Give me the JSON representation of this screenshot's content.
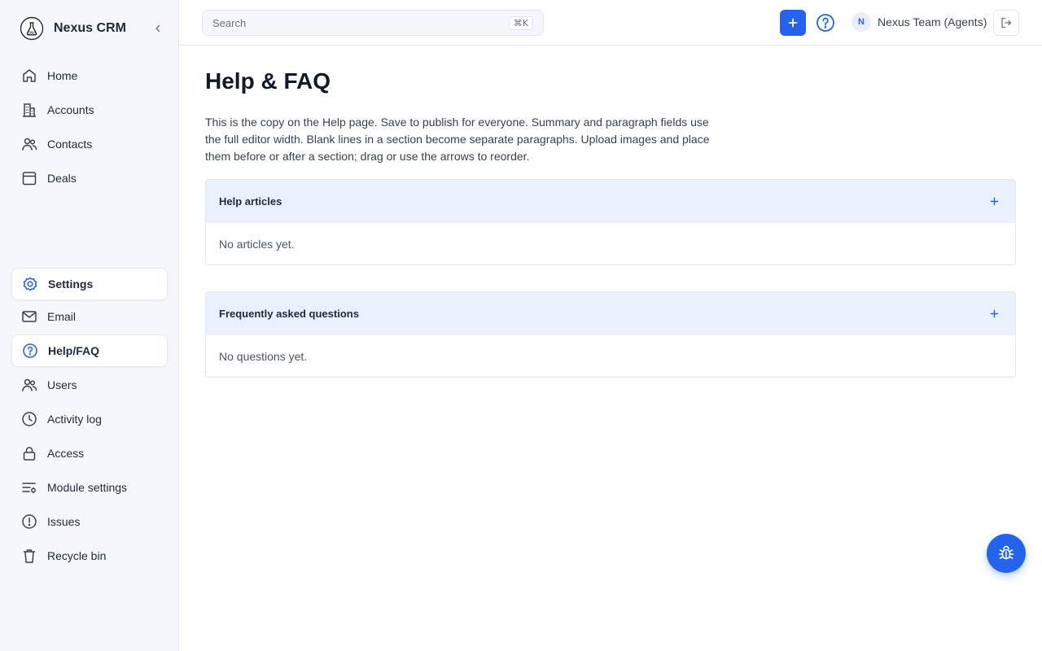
{
  "app": {
    "name": "Nexus CRM"
  },
  "sidebar": {
    "primary": [
      {
        "label": "Home",
        "icon": "home-icon"
      },
      {
        "label": "Accounts",
        "icon": "building-icon"
      },
      {
        "label": "Contacts",
        "icon": "users-icon"
      },
      {
        "label": "Deals",
        "icon": "calendar-icon"
      }
    ],
    "secondary": [
      {
        "label": "Settings",
        "icon": "settings-icon",
        "active": true
      },
      {
        "label": "Email",
        "icon": "mail-icon"
      },
      {
        "label": "Help/FAQ",
        "icon": "help-circle-icon",
        "active": true
      },
      {
        "label": "Users",
        "icon": "users-icon"
      },
      {
        "label": "Activity log",
        "icon": "clock-icon"
      },
      {
        "label": "Access",
        "icon": "lock-icon"
      },
      {
        "label": "Module settings",
        "icon": "sliders-icon"
      },
      {
        "label": "Issues",
        "icon": "alert-circle-icon"
      },
      {
        "label": "Recycle bin",
        "icon": "trash-icon"
      }
    ]
  },
  "topbar": {
    "search_placeholder": "Search",
    "search_shortcut": "⌘K",
    "avatar_initial": "N",
    "user_name": "Nexus Team (Agents)"
  },
  "main": {
    "title": "Help & FAQ",
    "intro": "This is the copy on the Help page. Save to publish for everyone. Summary and paragraph fields use the full editor width. Blank lines in a section become separate paragraphs. Upload images and place them before or after a section; drag or use the arrows to reorder.",
    "panels": [
      {
        "title": "Help articles",
        "empty": "No articles yet."
      },
      {
        "title": "Frequently asked questions",
        "empty": "No questions yet."
      }
    ]
  },
  "colors": {
    "accent": "#2563eb",
    "panel_header": "#ebf0fd",
    "sidebar_bg": "#f5f7fa"
  }
}
